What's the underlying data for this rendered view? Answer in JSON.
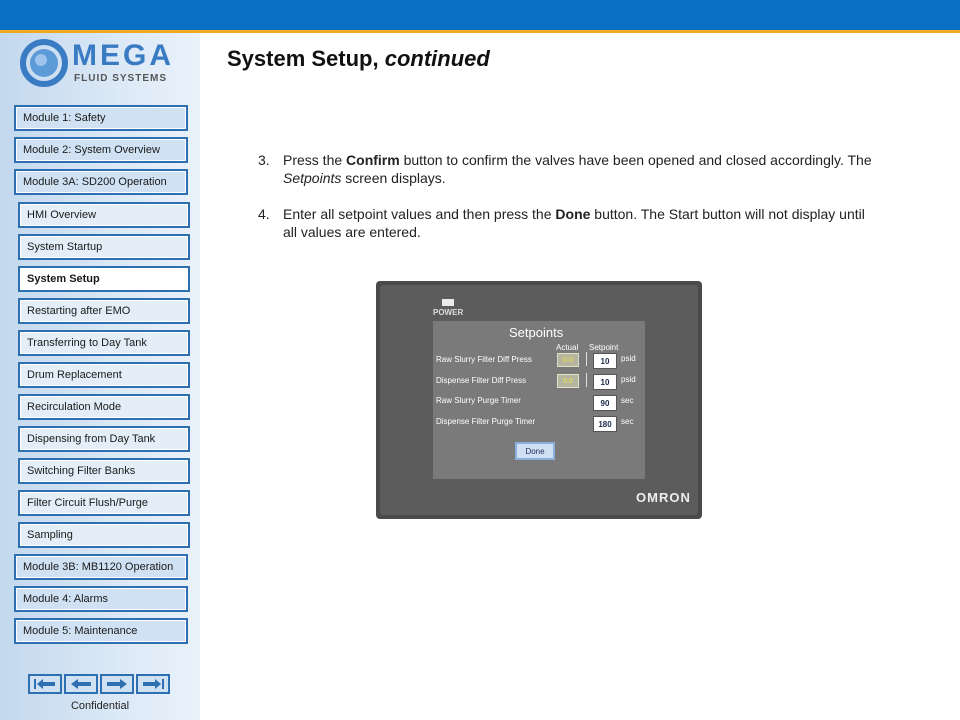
{
  "logo": {
    "word": "MEGA",
    "tagline": "FLUID SYSTEMS"
  },
  "nav": {
    "module1": "Module 1: Safety",
    "module2": "Module 2: System Overview",
    "module3a": "Module 3A: SD200 Operation",
    "sub": [
      "HMI Overview",
      "System Startup",
      "System Setup",
      "Restarting after EMO",
      "Transferring to Day Tank",
      "Drum Replacement",
      "Recirculation Mode",
      "Dispensing from Day Tank",
      "Switching Filter Banks",
      "Filter Circuit Flush/Purge",
      "Sampling"
    ],
    "module3b": "Module 3B: MB1120 Operation",
    "module4": "Module 4: Alarms",
    "module5": "Module 5: Maintenance"
  },
  "footer": {
    "confidential": "Confidential"
  },
  "page": {
    "title": "System Setup,",
    "title_italic": "continued"
  },
  "steps": [
    {
      "num": "3.",
      "a": "Press the ",
      "b": "Confirm",
      "c": " button to confirm the valves have been opened and closed accordingly. The ",
      "d": "Setpoints",
      "e": " screen displays."
    },
    {
      "num": "4.",
      "a": "Enter all setpoint values and then press the ",
      "b": "Done",
      "c": " button. The Start button will not display until all values are entered."
    }
  ],
  "hmi": {
    "power": "POWER",
    "brand": "OMRON",
    "screen_title": "Setpoints",
    "col_actual": "Actual",
    "col_setpoint": "Setpoint",
    "rows": [
      {
        "label": "Raw Slurry Filter Diff Press",
        "actual": "0.0",
        "setpoint": "10",
        "unit": "psid"
      },
      {
        "label": "Dispense Filter Diff Press",
        "actual": "0.0",
        "setpoint": "10",
        "unit": "psid"
      },
      {
        "label": "Raw Slurry Purge Timer",
        "setpoint": "90",
        "unit": "sec"
      },
      {
        "label": "Dispense Filter Purge Timer",
        "setpoint": "180",
        "unit": "sec"
      }
    ],
    "done": "Done"
  }
}
